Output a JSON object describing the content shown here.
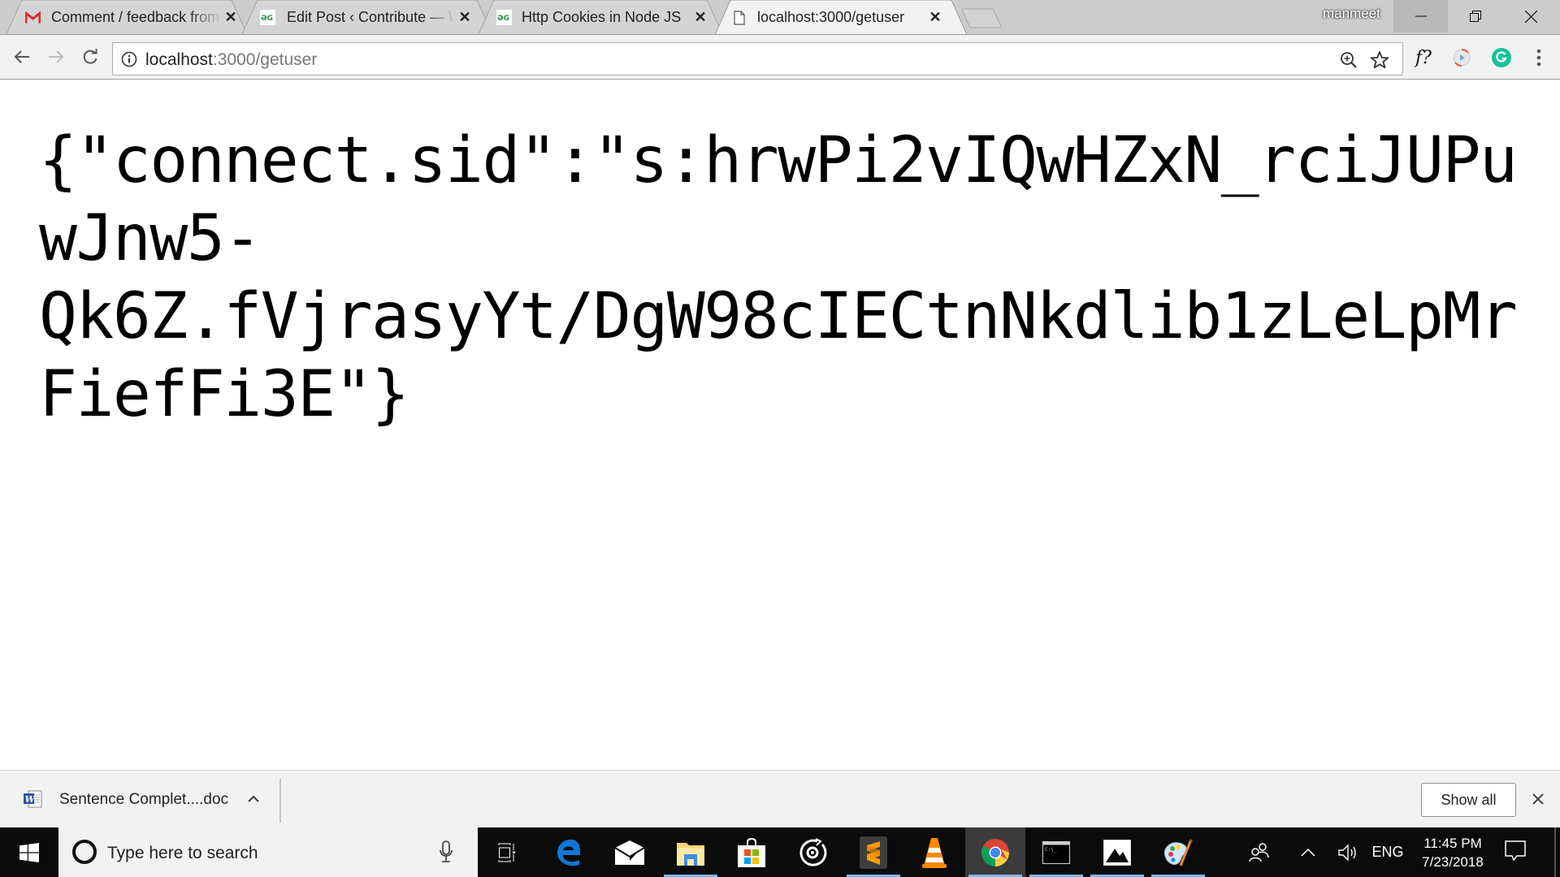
{
  "browser": {
    "profile_name": "manmeet",
    "tabs": [
      {
        "title": "Comment / feedback from",
        "favicon": "gmail-icon",
        "active": false
      },
      {
        "title": "Edit Post ‹ Contribute — \\",
        "favicon": "geeksforgeeks-icon",
        "active": false
      },
      {
        "title": "Http Cookies in Node JS |",
        "favicon": "geeksforgeeks-icon",
        "active": false
      },
      {
        "title": "localhost:3000/getuser",
        "favicon": "page-icon",
        "active": true
      }
    ],
    "close_glyph": "✕",
    "address": {
      "host": "localhost",
      "path": ":3000/getuser"
    },
    "extensions": [
      "fx-equation-extension",
      "media-extension",
      "grammarly-extension"
    ]
  },
  "page": {
    "body_text": "{\"connect.sid\":\"s:hrwPi2vIQwHZxN_rciJUPuwJnw5-\nQk6Z.fVjrasyYt/DgW98cIECtnNkdlib1zLeLpMrFiefFi3E\"}"
  },
  "downloads": {
    "items": [
      {
        "name": "Sentence Complet....doc",
        "type": "word-doc"
      }
    ],
    "show_all_label": "Show all"
  },
  "taskbar": {
    "search_placeholder": "Type here to search",
    "apps": [
      "task-view",
      "edge",
      "mail",
      "file-explorer",
      "store",
      "groove-music",
      "sublime-text",
      "vlc",
      "chrome",
      "command-prompt",
      "photos",
      "paint"
    ],
    "language": "ENG",
    "time": "11:45 PM",
    "date": "7/23/2018"
  },
  "colors": {
    "tabstrip_bg": "#cccccc",
    "active_tab_bg": "#f2f2f2",
    "taskbar_bg": "#0b0b0b",
    "grammarly_green": "#15c39a",
    "taskbar_indicator": "#76b9ed"
  }
}
